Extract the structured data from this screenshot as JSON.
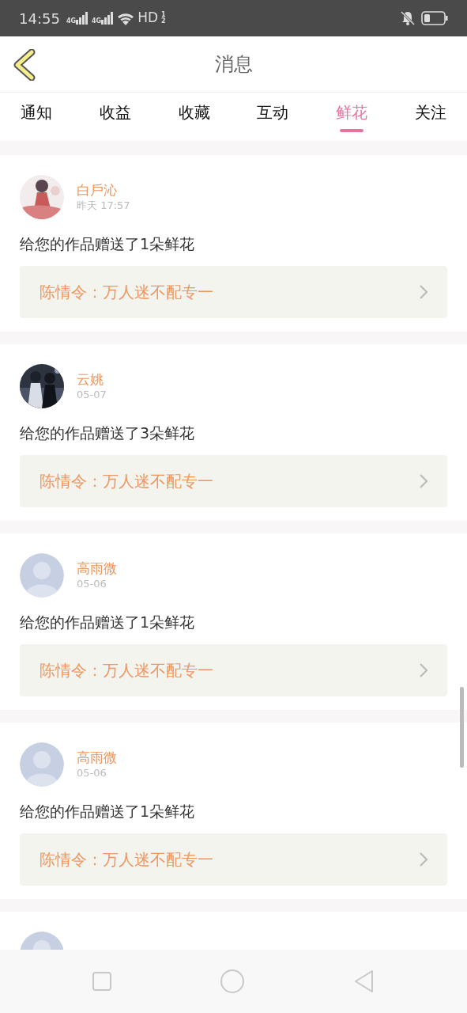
{
  "status_bar": {
    "time": "14:55",
    "networks": [
      "4G",
      "4G"
    ],
    "hd": "HD",
    "hd_slots": [
      "1",
      "2"
    ]
  },
  "header": {
    "title": "消息"
  },
  "tabs": [
    {
      "label": "通知",
      "selected": false
    },
    {
      "label": "收益",
      "selected": false
    },
    {
      "label": "收藏",
      "selected": false
    },
    {
      "label": "互动",
      "selected": false
    },
    {
      "label": "鲜花",
      "selected": true
    },
    {
      "label": "关注",
      "selected": false
    }
  ],
  "messages": [
    {
      "name": "白戶沁",
      "time": "昨天 17:57",
      "text": "给您的作品赠送了1朵鲜花",
      "work": "陈情令：万人迷不配专一"
    },
    {
      "name": "云姚",
      "time": "05-07",
      "text": "给您的作品赠送了3朵鲜花",
      "work": "陈情令：万人迷不配专一"
    },
    {
      "avatar": {
        "kind": "default"
      },
      "name": "高雨微",
      "time": "05-06",
      "text": "给您的作品赠送了1朵鲜花",
      "work": "陈情令：万人迷不配专一"
    },
    {
      "avatar": {
        "kind": "default"
      },
      "name": "高雨微",
      "time": "05-06",
      "text": "给您的作品赠送了1朵鲜花",
      "work": "陈情令：万人迷不配专一"
    },
    {
      "avatar": {
        "kind": "default"
      }
    }
  ]
}
